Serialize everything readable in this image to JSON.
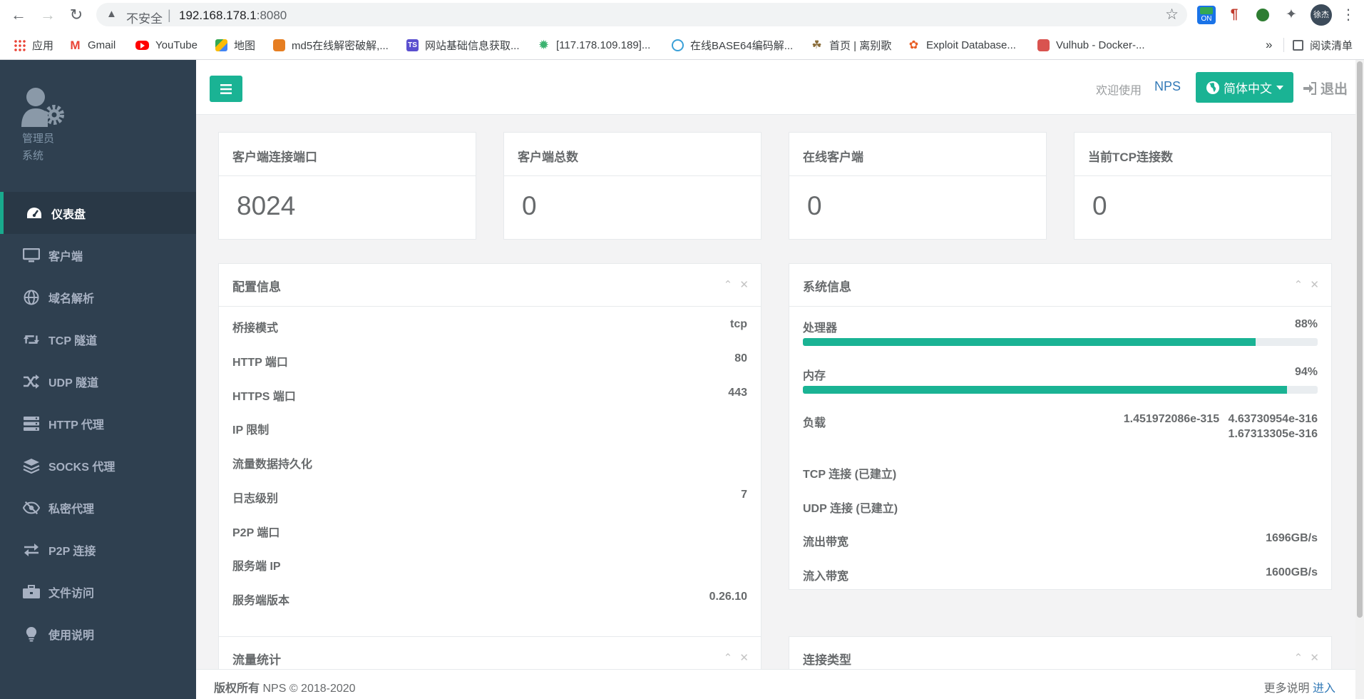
{
  "browser": {
    "insecure_label": "不安全",
    "url_separator": "|",
    "url_host": "192.168.178.1",
    "url_port": ":8080",
    "extension_on_label": "ON",
    "profile_avatar_text": "徐杰",
    "bookmarks": [
      {
        "label": "应用",
        "icon": "apps-grid-icon",
        "color": "#4285f4"
      },
      {
        "label": "Gmail",
        "icon": "gmail-icon",
        "color": "#ea4335"
      },
      {
        "label": "YouTube",
        "icon": "youtube-icon",
        "color": "#ff0000"
      },
      {
        "label": "地图",
        "icon": "maps-icon",
        "color": "#34a853"
      },
      {
        "label": "md5在线解密破解,...",
        "icon": "md5-icon",
        "color": "#e67e22"
      },
      {
        "label": "网站基础信息获取...",
        "icon": "ts-icon",
        "color": "#5a4fcf"
      },
      {
        "label": "[117.178.109.189]...",
        "icon": "gear-green-icon",
        "color": "#3cb371"
      },
      {
        "label": "在线BASE64编码解...",
        "icon": "base64-icon",
        "color": "#3aa0d8"
      },
      {
        "label": "首页 | 离别歌",
        "icon": "leaf-icon",
        "color": "#8a6d3b"
      },
      {
        "label": "Exploit Database...",
        "icon": "exploit-db-icon",
        "color": "#e85d24"
      },
      {
        "label": "Vulhub - Docker-...",
        "icon": "vulhub-icon",
        "color": "#d9534f"
      }
    ],
    "more_bookmarks": "»",
    "reading_list": "阅读清单"
  },
  "sidebar": {
    "user_name": "管理员",
    "user_role": "系统",
    "items": [
      {
        "label": "仪表盘",
        "icon": "dashboard-icon",
        "active": true
      },
      {
        "label": "客户端",
        "icon": "monitor-icon",
        "active": false
      },
      {
        "label": "域名解析",
        "icon": "globe-icon",
        "active": false
      },
      {
        "label": "TCP 隧道",
        "icon": "retweet-icon",
        "active": false
      },
      {
        "label": "UDP 隧道",
        "icon": "shuffle-icon",
        "active": false
      },
      {
        "label": "HTTP 代理",
        "icon": "server-icon",
        "active": false
      },
      {
        "label": "SOCKS 代理",
        "icon": "layers-icon",
        "active": false
      },
      {
        "label": "私密代理",
        "icon": "eye-slash-icon",
        "active": false
      },
      {
        "label": "P2P 连接",
        "icon": "exchange-icon",
        "active": false
      },
      {
        "label": "文件访问",
        "icon": "briefcase-icon",
        "active": false
      },
      {
        "label": "使用说明",
        "icon": "lightbulb-icon",
        "active": false
      }
    ]
  },
  "topbar": {
    "welcome": "欢迎使用",
    "brand": "NPS",
    "language": "简体中文",
    "logout": "退出"
  },
  "stats": [
    {
      "title": "客户端连接端口",
      "value": "8024"
    },
    {
      "title": "客户端总数",
      "value": "0"
    },
    {
      "title": "在线客户端",
      "value": "0"
    },
    {
      "title": "当前TCP连接数",
      "value": "0"
    }
  ],
  "config_panel": {
    "title": "配置信息",
    "rows": [
      {
        "key": "桥接模式",
        "value": "tcp"
      },
      {
        "key": "HTTP 端口",
        "value": "80"
      },
      {
        "key": "HTTPS 端口",
        "value": "443"
      },
      {
        "key": "IP 限制",
        "value": ""
      },
      {
        "key": "流量数据持久化",
        "value": ""
      },
      {
        "key": "日志级别",
        "value": "7"
      },
      {
        "key": "P2P 端口",
        "value": ""
      },
      {
        "key": "服务端 IP",
        "value": ""
      },
      {
        "key": "服务端版本",
        "value": "0.26.10"
      }
    ]
  },
  "system_panel": {
    "title": "系统信息",
    "cpu_label": "处理器",
    "cpu_value": "88%",
    "cpu_percent": 88,
    "mem_label": "内存",
    "mem_value": "94%",
    "mem_percent": 94,
    "load_label": "负载",
    "load_values_line1": "1.451972086e-315 4.63730954e-316",
    "load_values_line2": "1.67313305e-316",
    "tcp_label": "TCP 连接 (已建立)",
    "tcp_value": "",
    "udp_label": "UDP 连接 (已建立)",
    "udp_value": "",
    "out_label": "流出带宽",
    "out_value": "1696GB/s",
    "in_label": "流入带宽",
    "in_value": "1600GB/s"
  },
  "traffic_panel": {
    "title": "流量统计"
  },
  "conn_type_panel": {
    "title": "连接类型"
  },
  "footer": {
    "copyright_label": "版权所有",
    "copyright_text": "NPS © 2018-2020",
    "more_label": "更多说明",
    "more_link": "进入"
  },
  "colors": {
    "sidebar": "#2f4050",
    "accent": "#1ab394",
    "link": "#337ab7"
  }
}
